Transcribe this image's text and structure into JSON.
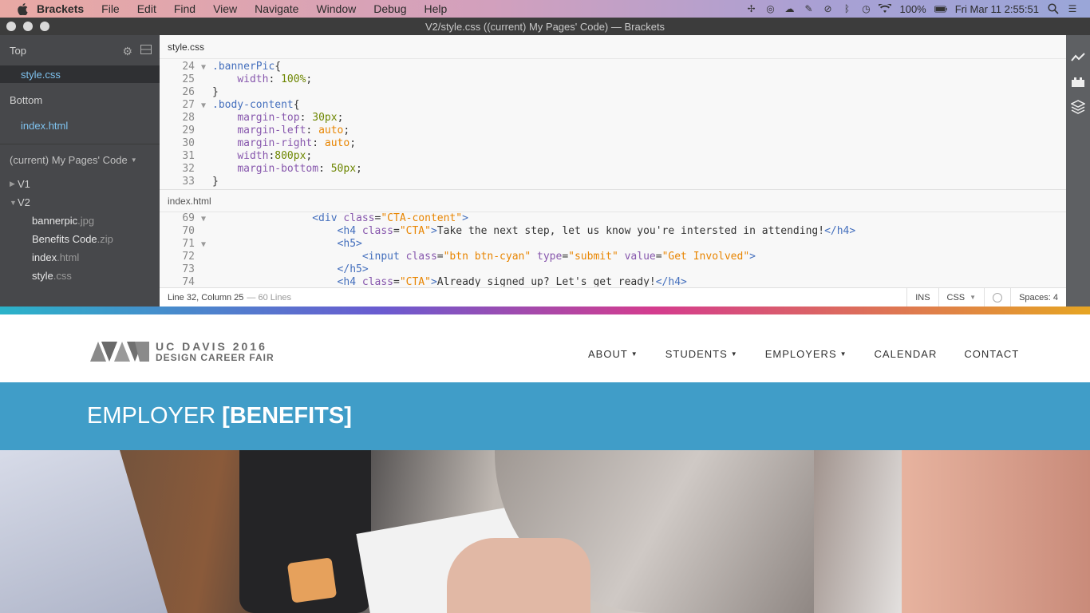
{
  "menubar": {
    "app_name": "Brackets",
    "items": [
      "File",
      "Edit",
      "Find",
      "View",
      "Navigate",
      "Window",
      "Debug",
      "Help"
    ],
    "battery": "100%",
    "datetime": "Fri Mar 11  2:55:51"
  },
  "window": {
    "title": "V2/style.css ((current) My Pages' Code) — Brackets"
  },
  "sidebar": {
    "top_label": "Top",
    "top_file": "style.css",
    "bottom_label": "Bottom",
    "bottom_file": "index.html",
    "project_label": "(current) My Pages' Code",
    "folders": [
      {
        "name": "V1",
        "expanded": false
      },
      {
        "name": "V2",
        "expanded": true
      }
    ],
    "files": [
      {
        "base": "bannerpic",
        "ext": ".jpg"
      },
      {
        "base": "Benefits Code",
        "ext": ".zip"
      },
      {
        "base": "index",
        "ext": ".html"
      },
      {
        "base": "style",
        "ext": ".css"
      }
    ]
  },
  "editor": {
    "top_pane_title": "style.css",
    "top_lines": [
      {
        "n": "24",
        "fold": "▼",
        "tokens": [
          [
            "c-sel",
            ".bannerPic"
          ],
          [
            "c-pun",
            "{"
          ]
        ]
      },
      {
        "n": "25",
        "fold": "",
        "tokens": [
          [
            "c-pun",
            "    "
          ],
          [
            "c-prop",
            "width"
          ],
          [
            "c-pun",
            ": "
          ],
          [
            "c-num",
            "100%"
          ],
          [
            "c-pun",
            ";"
          ]
        ]
      },
      {
        "n": "26",
        "fold": "",
        "tokens": [
          [
            "c-pun",
            "}"
          ]
        ]
      },
      {
        "n": "27",
        "fold": "▼",
        "tokens": [
          [
            "c-sel",
            ".body-content"
          ],
          [
            "c-pun",
            "{"
          ]
        ]
      },
      {
        "n": "28",
        "fold": "",
        "tokens": [
          [
            "c-pun",
            "    "
          ],
          [
            "c-prop",
            "margin-top"
          ],
          [
            "c-pun",
            ": "
          ],
          [
            "c-num",
            "30px"
          ],
          [
            "c-pun",
            ";"
          ]
        ]
      },
      {
        "n": "29",
        "fold": "",
        "tokens": [
          [
            "c-pun",
            "    "
          ],
          [
            "c-prop",
            "margin-left"
          ],
          [
            "c-pun",
            ": "
          ],
          [
            "c-val",
            "auto"
          ],
          [
            "c-pun",
            ";"
          ]
        ]
      },
      {
        "n": "30",
        "fold": "",
        "tokens": [
          [
            "c-pun",
            "    "
          ],
          [
            "c-prop",
            "margin-right"
          ],
          [
            "c-pun",
            ": "
          ],
          [
            "c-val",
            "auto"
          ],
          [
            "c-pun",
            ";"
          ]
        ]
      },
      {
        "n": "31",
        "fold": "",
        "tokens": [
          [
            "c-pun",
            "    "
          ],
          [
            "c-prop",
            "width"
          ],
          [
            "c-pun",
            ":"
          ],
          [
            "c-num",
            "800px"
          ],
          [
            "c-pun",
            ";"
          ]
        ]
      },
      {
        "n": "32",
        "fold": "",
        "tokens": [
          [
            "c-pun",
            "    "
          ],
          [
            "c-prop",
            "margin-bottom"
          ],
          [
            "c-pun",
            ": "
          ],
          [
            "c-num",
            "50px"
          ],
          [
            "c-pun",
            ";"
          ]
        ]
      },
      {
        "n": "33",
        "fold": "",
        "tokens": [
          [
            "c-pun",
            "}"
          ]
        ]
      }
    ],
    "bottom_pane_title": "index.html",
    "bottom_lines": [
      {
        "n": "69",
        "fold": "▼",
        "tokens": [
          [
            "c-pun",
            "                "
          ],
          [
            "c-tag",
            "<div "
          ],
          [
            "c-attr",
            "class"
          ],
          [
            "c-pun",
            "="
          ],
          [
            "c-str",
            "\"CTA-content\""
          ],
          [
            "c-tag",
            ">"
          ]
        ]
      },
      {
        "n": "70",
        "fold": "",
        "tokens": [
          [
            "c-pun",
            "                    "
          ],
          [
            "c-tag",
            "<h4 "
          ],
          [
            "c-attr",
            "class"
          ],
          [
            "c-pun",
            "="
          ],
          [
            "c-str",
            "\"CTA\""
          ],
          [
            "c-tag",
            ">"
          ],
          [
            "c-txt",
            "Take the next step, let us know you're intersted in attending!"
          ],
          [
            "c-tag",
            "</h4>"
          ]
        ]
      },
      {
        "n": "71",
        "fold": "▼",
        "tokens": [
          [
            "c-pun",
            "                    "
          ],
          [
            "c-tag",
            "<h5>"
          ]
        ]
      },
      {
        "n": "72",
        "fold": "",
        "tokens": [
          [
            "c-pun",
            "                        "
          ],
          [
            "c-tag",
            "<input "
          ],
          [
            "c-attr",
            "class"
          ],
          [
            "c-pun",
            "="
          ],
          [
            "c-str",
            "\"btn btn-cyan\""
          ],
          [
            "c-pun",
            " "
          ],
          [
            "c-attr",
            "type"
          ],
          [
            "c-pun",
            "="
          ],
          [
            "c-str",
            "\"submit\""
          ],
          [
            "c-pun",
            " "
          ],
          [
            "c-attr",
            "value"
          ],
          [
            "c-pun",
            "="
          ],
          [
            "c-str",
            "\"Get Involved\""
          ],
          [
            "c-tag",
            ">"
          ]
        ]
      },
      {
        "n": "73",
        "fold": "",
        "tokens": [
          [
            "c-pun",
            "                    "
          ],
          [
            "c-tag",
            "</h5>"
          ]
        ]
      },
      {
        "n": "74",
        "fold": "",
        "tokens": [
          [
            "c-pun",
            "                    "
          ],
          [
            "c-tag",
            "<h4 "
          ],
          [
            "c-attr",
            "class"
          ],
          [
            "c-pun",
            "="
          ],
          [
            "c-str",
            "\"CTA\""
          ],
          [
            "c-tag",
            ">"
          ],
          [
            "c-txt",
            "Already signed up? Let's get ready!"
          ],
          [
            "c-tag",
            "</h4>"
          ]
        ]
      }
    ]
  },
  "statusbar": {
    "position": "Line 32, Column 25",
    "lines": "— 60 Lines",
    "mode": "INS",
    "language": "CSS",
    "spaces": "Spaces:  4"
  },
  "site": {
    "logo_line1": "UC DAVIS 2016",
    "logo_line2": "DESIGN CAREER FAIR",
    "nav": [
      {
        "label": "ABOUT",
        "dropdown": true
      },
      {
        "label": "STUDENTS",
        "dropdown": true
      },
      {
        "label": "EMPLOYERS",
        "dropdown": true
      },
      {
        "label": "CALENDAR",
        "dropdown": false
      },
      {
        "label": "CONTACT",
        "dropdown": false
      }
    ],
    "banner_plain": "EMPLOYER",
    "banner_bold": "[BENEFITS]"
  },
  "colors": {
    "banner_bg": "#409dc8",
    "editor_bg": "#f8f8f8",
    "sidebar_bg": "#47484b",
    "link_blue": "#7fc3f0"
  }
}
